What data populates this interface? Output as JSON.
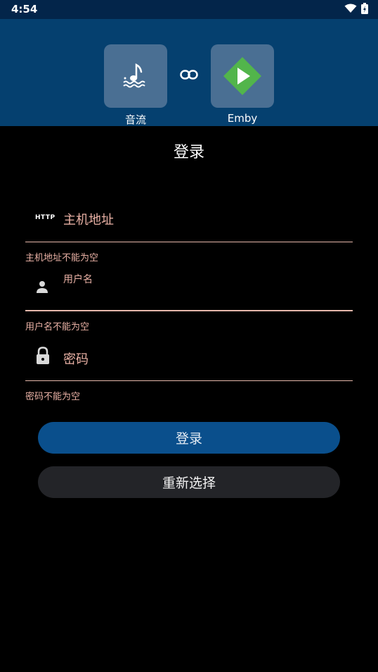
{
  "status_bar": {
    "time": "4:54"
  },
  "header": {
    "left_app": {
      "label": "音流",
      "icon": "music-note-icon"
    },
    "link_icon": "link-icon",
    "right_app": {
      "label": "Emby",
      "icon": "emby-logo-icon"
    }
  },
  "title": "登录",
  "fields": {
    "host": {
      "icon": "http-icon",
      "icon_text": "HTTP",
      "placeholder": "主机地址",
      "error": "主机地址不能为空"
    },
    "username": {
      "icon": "person-icon",
      "floating_label": "用户名",
      "error": "用户名不能为空"
    },
    "password": {
      "icon": "lock-icon",
      "placeholder": "密码",
      "error": "密码不能为空"
    }
  },
  "buttons": {
    "login": "登录",
    "reselect": "重新选择"
  },
  "colors": {
    "header_bg": "#05406f",
    "status_bg": "#03254a",
    "tile_bg": "#4a6f93",
    "error": "#e9b1a5",
    "primary_button": "#0a4f8c",
    "secondary_button": "#232428",
    "emby_green": "#52b54b"
  }
}
